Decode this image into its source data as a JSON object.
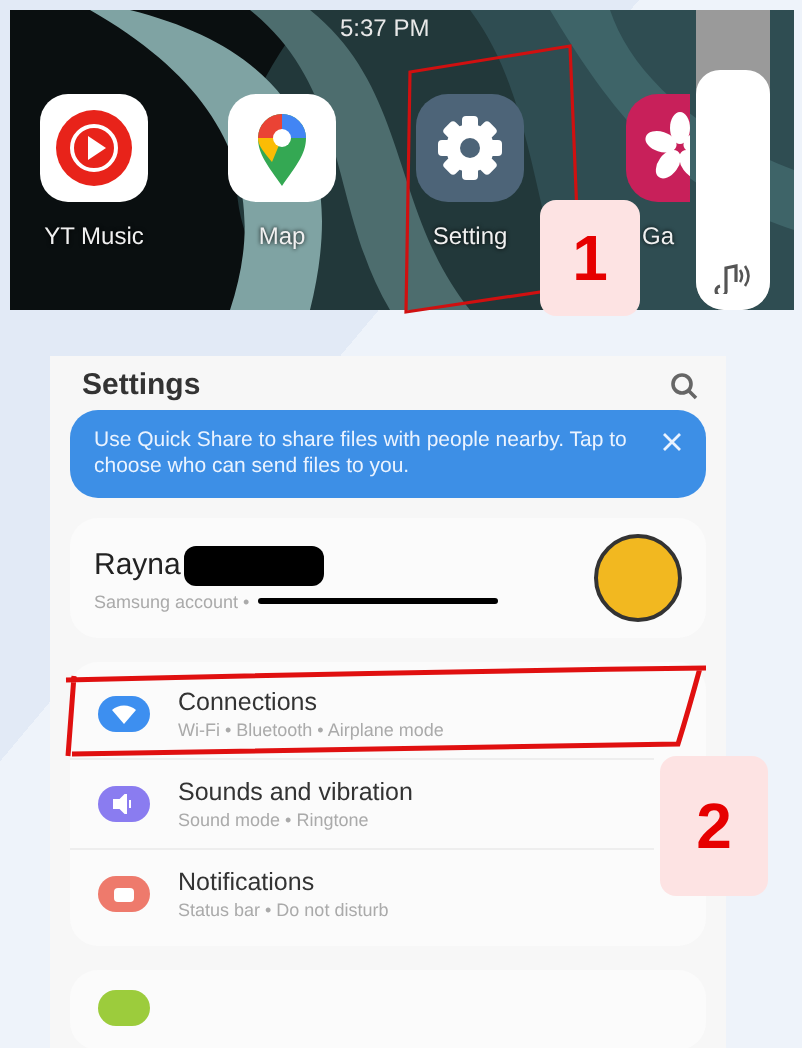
{
  "home_screen": {
    "time": "5:37 PM",
    "apps": [
      {
        "label": "YT Music",
        "kind": "music"
      },
      {
        "label": "Map",
        "kind": "maps"
      },
      {
        "label": "Setting",
        "kind": "settings"
      },
      {
        "label": "Ga",
        "kind": "gallery"
      }
    ],
    "volume": {
      "level": 0.8
    }
  },
  "settings": {
    "title": "Settings",
    "banner": {
      "text": "Use Quick Share to share files with people nearby. Tap to choose who can send files to you."
    },
    "account": {
      "name": "Rayna",
      "subtitle": "Samsung account •"
    },
    "items": [
      {
        "title": "Connections",
        "subtitle": "Wi-Fi • Bluetooth • Airplane mode",
        "kind": "wifi",
        "color": "#3d8ff0"
      },
      {
        "title": "Sounds and vibration",
        "subtitle": "Sound mode • Ringtone",
        "kind": "sound",
        "color": "#8a7cf0"
      },
      {
        "title": "Notifications",
        "subtitle": "Status bar • Do not disturb",
        "kind": "notifications",
        "color": "#ee7a6c"
      }
    ]
  },
  "annotations": [
    {
      "label": "1"
    },
    {
      "label": "2"
    }
  ]
}
